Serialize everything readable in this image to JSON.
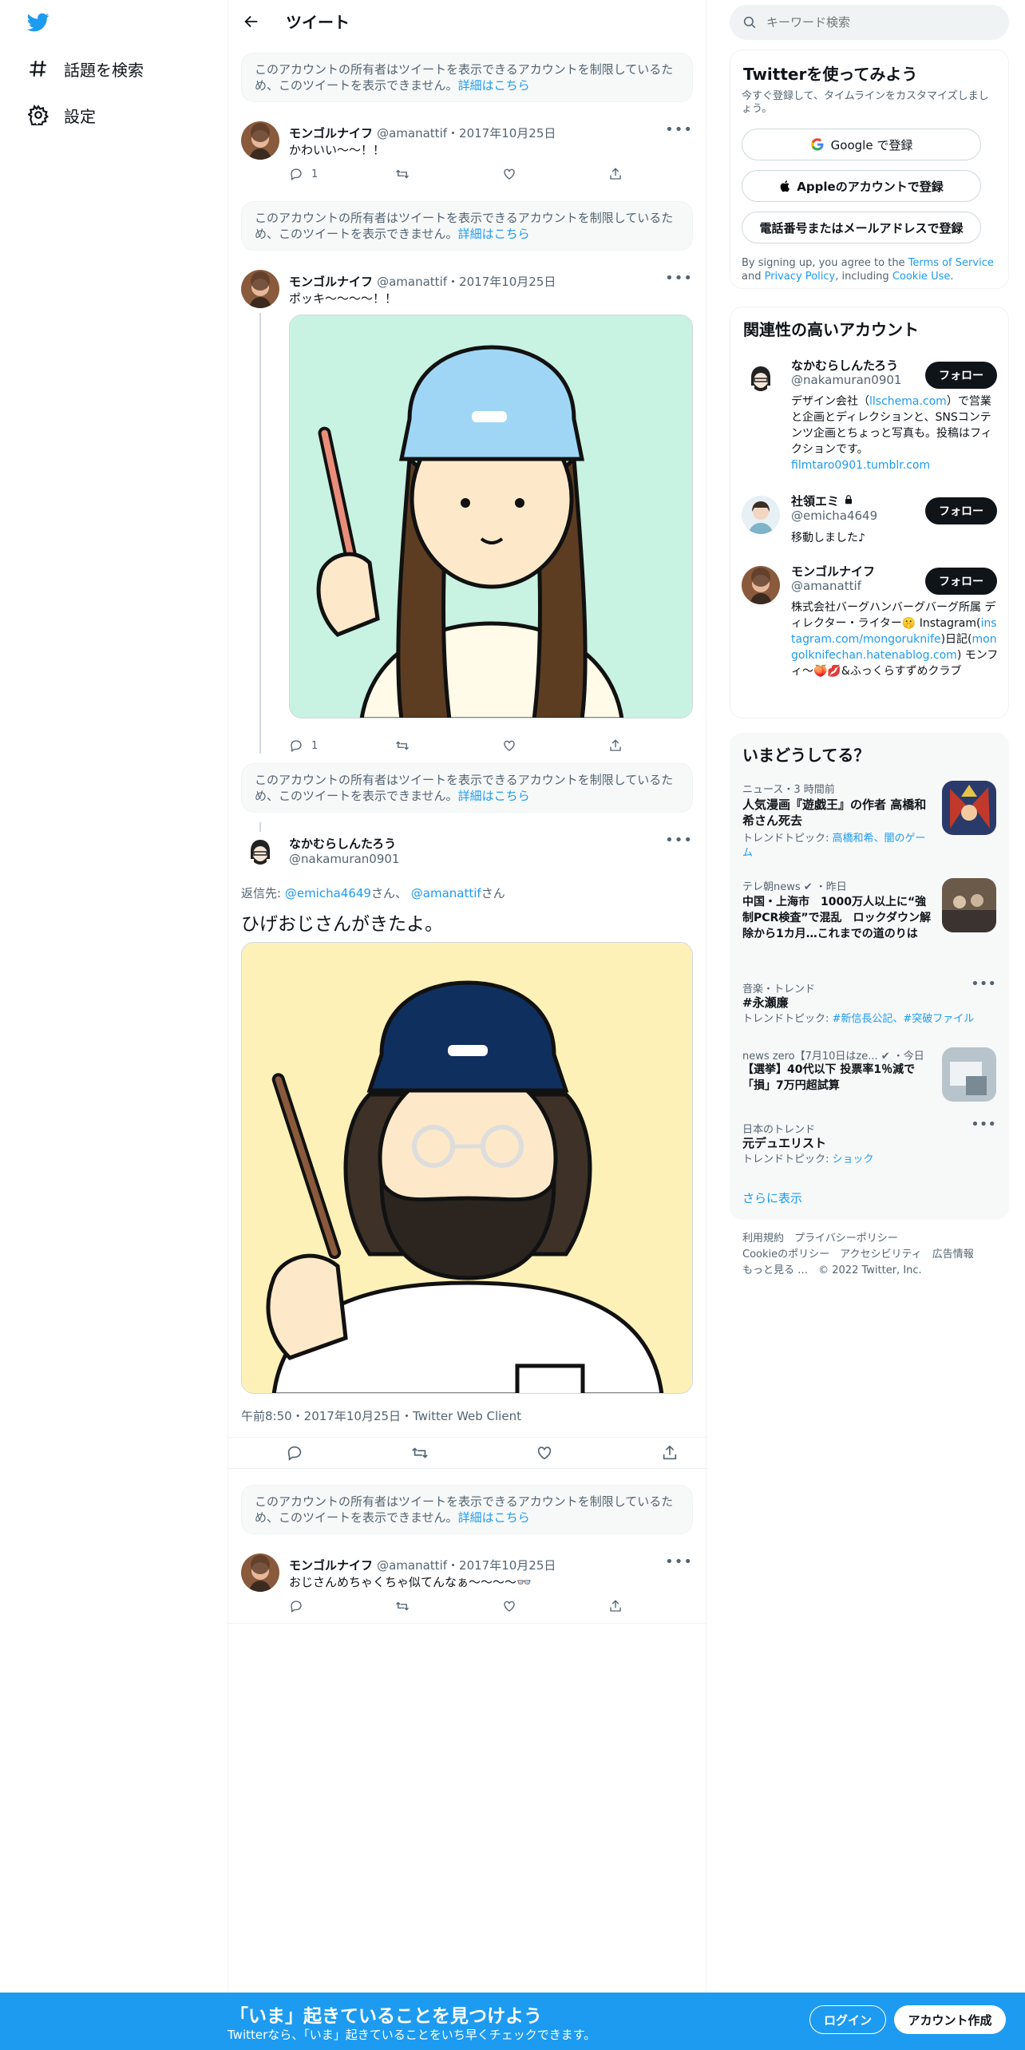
{
  "nav": {
    "explore_label": "話題を検索",
    "settings_label": "設定"
  },
  "header": {
    "title": "ツイート"
  },
  "restricted": {
    "text": "このアカウントの所有者はツイートを表示できるアカウントを制限しているため、このツイートを表示できません。",
    "link": "詳細はこちら"
  },
  "tweets": [
    {
      "name": "モンゴルナイフ",
      "handle": "@amanattif",
      "date": "2017年10月25日",
      "text": "かわいい〜〜！！",
      "replies": "1"
    },
    {
      "name": "モンゴルナイフ",
      "handle": "@amanattif",
      "date": "2017年10月25日",
      "text": "ポッキ〜〜〜〜！！",
      "replies": "1"
    },
    {
      "name": "モンゴルナイフ",
      "handle": "@amanattif",
      "date": "2017年10月25日",
      "text": "おじさんめちゃくちゃ似てんなぁ〜〜〜〜👓"
    }
  ],
  "focus": {
    "name": "なかむらしんたろう",
    "handle": "@nakamuran0901",
    "reply_prefix": "返信先:",
    "reply_to_1": "@emicha4649",
    "reply_suffix_1": "さん、",
    "reply_to_2": "@amanattif",
    "reply_suffix_2": "さん",
    "text": "ひげおじさんがきたよ。",
    "timestamp": "午前8:50・2017年10月25日・Twitter Web Client"
  },
  "search": {
    "placeholder": "キーワード検索"
  },
  "signup": {
    "title": "Twitterを使ってみよう",
    "subtitle": "今すぐ登録して、タイムラインをカスタマイズしましょう。",
    "google": "Google で登録",
    "apple": "Appleのアカウントで登録",
    "phone": "電話番号またはメールアドレスで登録",
    "terms_pre": "By signing up, you agree to the ",
    "terms_link": "Terms of Service",
    "terms_and": " and ",
    "privacy_link": "Privacy Policy",
    "terms_incl": ", including ",
    "cookie_link": "Cookie Use",
    "terms_end": "."
  },
  "related": {
    "title": "関連性の高いアカウント",
    "follow_label": "フォロー",
    "accounts": [
      {
        "name": "なかむらしんたろう",
        "handle": "@nakamuran0901",
        "bio_1": "デザイン会社（",
        "bio_link": "llschema.com",
        "bio_2": "）で営業と企画とディレクションと、SNSコンテンツ企画とちょっと写真も。投稿はフィクションです。",
        "bio_link2": "filmtaro0901.tumblr.com"
      },
      {
        "name": "社領エミ",
        "handle": "@emicha4649",
        "bio": "移動しました♪"
      },
      {
        "name": "モンゴルナイフ",
        "handle": "@amanattif",
        "bio_1": "株式会社バーグハンバーグバーグ所属 ディレクター・ライター🤫 Instagram(",
        "bio_link": "instagram.com/mongoruknife",
        "bio_2": ")日記(",
        "bio_link2": "mongolknifechan.hatenablog.com",
        "bio_3": ") モンフィ〜🍑💋&ふっくらすずめクラブ"
      }
    ]
  },
  "trends": {
    "title": "いまどうしてる？",
    "items": [
      {
        "cat": "ニュース・3 時間前",
        "title": "人気漫画『遊戯王』の作者 高橋和希さん死去",
        "sub_pre": "トレンドトピック: ",
        "sub_link": "高橋和希、闇のゲーム"
      },
      {
        "cat": "テレ朝news ✔ ・昨日",
        "title": "中国・上海市　1000万人以上に“強制PCR検査”で混乱　ロックダウン解除から1カ月…これまでの道のりは"
      },
      {
        "cat": "音楽・トレンド",
        "title": "#永瀬廉",
        "sub_pre": "トレンドトピック: ",
        "sub_link": "#新信長公記、#突破ファイル"
      },
      {
        "cat": "news zero【7月10日はze... ✔ ・今日",
        "title": "【選挙】40代以下 投票率1％減で「損」7万円超試算"
      },
      {
        "cat": "日本のトレンド",
        "title": "元デュエリスト",
        "sub_pre": "トレンドトピック: ",
        "sub_link": "ショック"
      }
    ],
    "more": "さらに表示"
  },
  "footer": {
    "line1": "利用規約　プライバシーポリシー",
    "line2": "Cookieのポリシー　アクセシビリティ　広告情報",
    "line3": "もっと見る …　© 2022 Twitter, Inc."
  },
  "bottom": {
    "title": "「いま」起きていることを見つけよう",
    "sub": "Twitterなら、「いま」起きていることをいち早くチェックできます。",
    "login": "ログイン",
    "signup": "アカウント作成"
  },
  "colors": {
    "accent": "#1d9bf0",
    "text": "#0f1419",
    "muted": "#536471"
  }
}
